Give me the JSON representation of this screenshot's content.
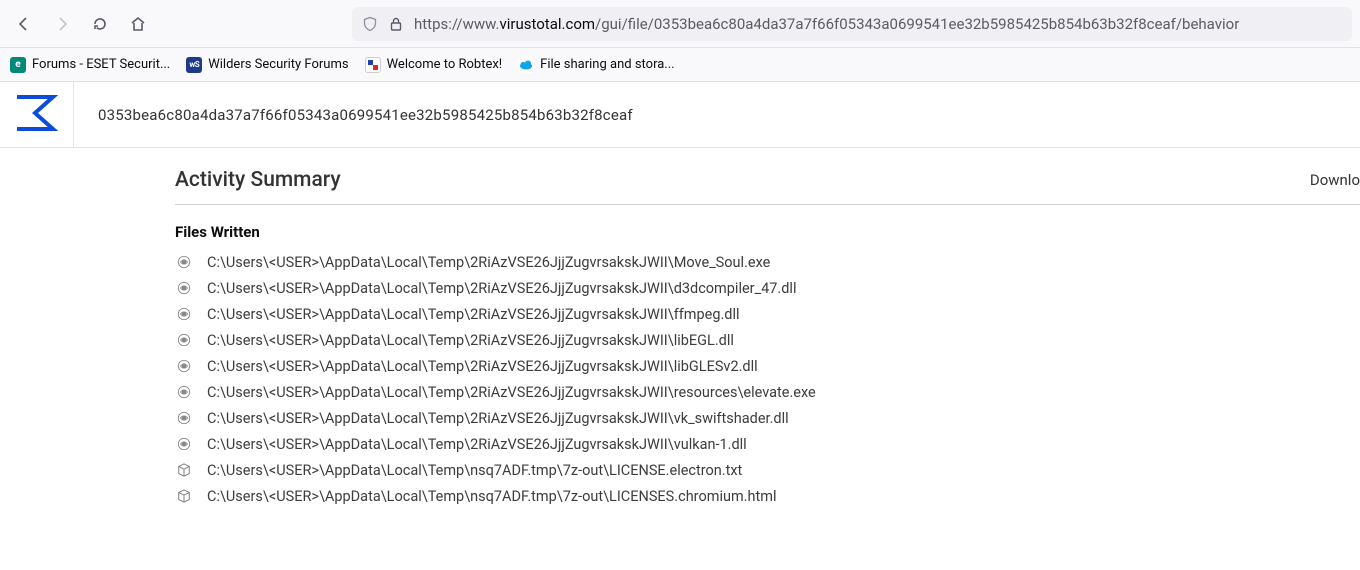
{
  "url": {
    "prefix": "https://www.",
    "domain": "virustotal.com",
    "suffix": "/gui/file/0353bea6c80a4da37a7f66f05343a0699541ee32b5985425b854b63b32f8ceaf/behavior"
  },
  "bookmarks": [
    {
      "label": "Forums - ESET Securit...",
      "iconClass": "bm-eset",
      "iconText": "e"
    },
    {
      "label": "Wilders Security Forums",
      "iconClass": "bm-ws",
      "iconText": "wS"
    },
    {
      "label": "Welcome to Robtex!",
      "iconClass": "bm-robtex",
      "iconText": ""
    },
    {
      "label": "File sharing and stora...",
      "iconClass": "bm-cloud",
      "iconText": ""
    }
  ],
  "hash": "0353bea6c80a4da37a7f66f05343a0699541ee32b5985425b854b63b32f8ceaf",
  "activity": {
    "title": "Activity Summary",
    "download": "Downlo"
  },
  "section": {
    "title": "Files Written"
  },
  "files": [
    {
      "icon": "eye",
      "path": "C:\\Users\\<USER>\\AppData\\Local\\Temp\\2RiAzVSE26JjjZugvrsakskJWII\\Move_Soul.exe"
    },
    {
      "icon": "eye",
      "path": "C:\\Users\\<USER>\\AppData\\Local\\Temp\\2RiAzVSE26JjjZugvrsakskJWII\\d3dcompiler_47.dll"
    },
    {
      "icon": "eye",
      "path": "C:\\Users\\<USER>\\AppData\\Local\\Temp\\2RiAzVSE26JjjZugvrsakskJWII\\ffmpeg.dll"
    },
    {
      "icon": "eye",
      "path": "C:\\Users\\<USER>\\AppData\\Local\\Temp\\2RiAzVSE26JjjZugvrsakskJWII\\libEGL.dll"
    },
    {
      "icon": "eye",
      "path": "C:\\Users\\<USER>\\AppData\\Local\\Temp\\2RiAzVSE26JjjZugvrsakskJWII\\libGLESv2.dll"
    },
    {
      "icon": "eye",
      "path": "C:\\Users\\<USER>\\AppData\\Local\\Temp\\2RiAzVSE26JjjZugvrsakskJWII\\resources\\elevate.exe"
    },
    {
      "icon": "eye",
      "path": "C:\\Users\\<USER>\\AppData\\Local\\Temp\\2RiAzVSE26JjjZugvrsakskJWII\\vk_swiftshader.dll"
    },
    {
      "icon": "eye",
      "path": "C:\\Users\\<USER>\\AppData\\Local\\Temp\\2RiAzVSE26JjjZugvrsakskJWII\\vulkan-1.dll"
    },
    {
      "icon": "box",
      "path": "C:\\Users\\<USER>\\AppData\\Local\\Temp\\nsq7ADF.tmp\\7z-out\\LICENSE.electron.txt"
    },
    {
      "icon": "box",
      "path": "C:\\Users\\<USER>\\AppData\\Local\\Temp\\nsq7ADF.tmp\\7z-out\\LICENSES.chromium.html"
    }
  ]
}
